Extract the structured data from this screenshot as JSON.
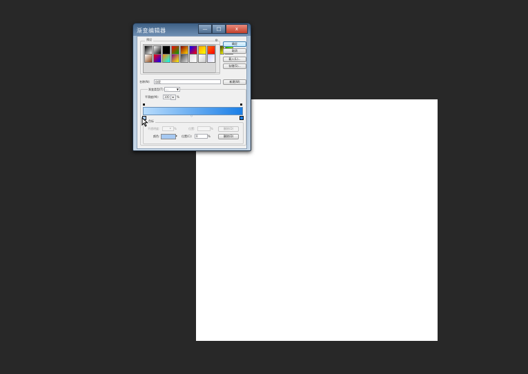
{
  "dialog": {
    "title": "渐变编辑器",
    "caption_buttons": {
      "minimize": "—",
      "maximize": "□",
      "close": "x"
    },
    "presets": {
      "label": "预设",
      "menu_glyph": "⚙",
      "swatches_row1": [
        "#000000|#ffffff",
        "#ffffff|#000000",
        "#000000|#000000",
        "#ff0000|#00aa00",
        "#8b0000|#ffd700",
        "#0000ff|#ff0000",
        "#ffa500|#ffff00",
        "#ff6600|#ff0000",
        "#000000|#ffff00",
        "#00aa00|#ffff00"
      ],
      "swatches_row2": [
        "#ffffff|#8b4513",
        "#ff0000|#0000ff",
        "#ff8800|#00ffff",
        "#880088|#ffff00",
        "#444444|#dddddd",
        "#dddddd|#ffffff",
        "#ffffff|#cccccc",
        "#ccccff|#ffffff"
      ]
    },
    "buttons": {
      "ok": "确定",
      "cancel": "取消",
      "load": "载入(L)...",
      "save": "存储(S)...",
      "new": "新建(W)"
    },
    "name_label": "名称(N):",
    "name_value": "自定",
    "gradient_type_label": "渐变类型(T):",
    "gradient_type_value": "...",
    "smoothness_label": "平滑度(M):",
    "smoothness_value": "100",
    "smoothness_unit": "%",
    "gradient": {
      "start_color": "#b8dcfc",
      "end_color": "#1a7ee6",
      "start_stop_color": "#a6c9f2",
      "end_stop_color": "#1a7ee6"
    },
    "color_stops": {
      "label": "色标",
      "opacity_label": "不透明度:",
      "opacity_value": "",
      "opacity_unit": "%",
      "location_label": "位置:",
      "location_value": "",
      "location_unit": "%",
      "delete_label": "删除(D)",
      "color_label": "颜色:",
      "color_swatch": "#a6c9f2",
      "color_location_label": "位置(C):",
      "color_location_value": "0",
      "color_location_unit": "%",
      "color_delete_label": "删除(D)"
    }
  }
}
